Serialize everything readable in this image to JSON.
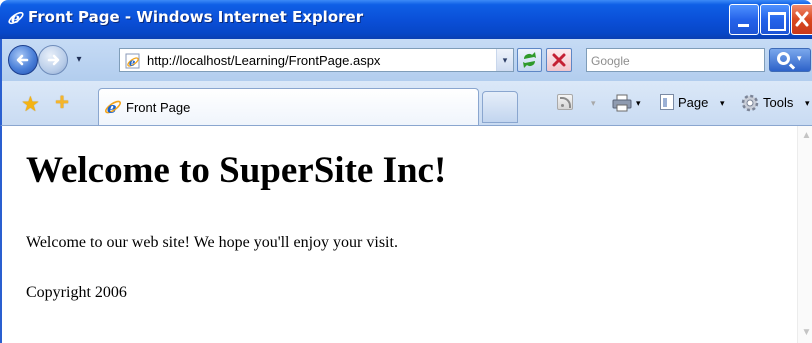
{
  "window": {
    "title": "Front Page - Windows Internet Explorer"
  },
  "address_bar": {
    "url": "http://localhost/Learning/FrontPage.aspx"
  },
  "search": {
    "placeholder": "Google"
  },
  "tabs": [
    {
      "label": "Front Page",
      "active": true
    }
  ],
  "command_bar": {
    "page_label": "Page",
    "tools_label": "Tools",
    "dropdown_glyph": "▾"
  },
  "page": {
    "heading": "Welcome to SuperSite Inc!",
    "paragraph": "Welcome to our web site! We hope you'll enjoy your visit.",
    "footer": "Copyright 2006"
  },
  "icons": {
    "window": "ie-logo-icon",
    "back": "back-arrow-icon",
    "forward": "forward-arrow-icon",
    "refresh": "refresh-icon",
    "stop": "stop-icon",
    "search": "search-icon",
    "favorites": "favorites-star-icon",
    "add_favorite": "add-favorite-icon",
    "feeds": "rss-feed-icon",
    "print": "print-icon",
    "page": "page-icon",
    "tools": "gear-icon"
  },
  "colors": {
    "titlebar": "#0a4ed6",
    "toolbar": "#c6dbf5",
    "tabbar": "#dbe8f8"
  }
}
